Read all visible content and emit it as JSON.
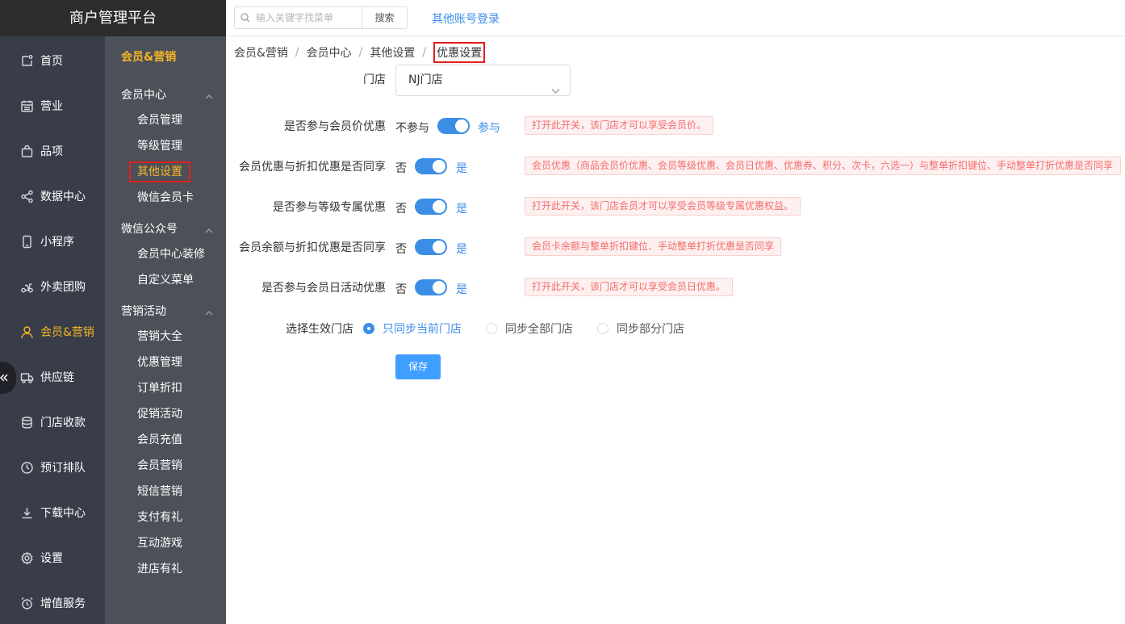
{
  "app": {
    "title": "商户管理平台"
  },
  "nav": [
    {
      "label": "首页",
      "icon": "home-icon"
    },
    {
      "label": "营业",
      "icon": "calendar-icon"
    },
    {
      "label": "品项",
      "icon": "bag-icon"
    },
    {
      "label": "数据中心",
      "icon": "share-icon"
    },
    {
      "label": "小程序",
      "icon": "phone-icon"
    },
    {
      "label": "外卖团购",
      "icon": "scooter-icon"
    },
    {
      "label": "会员&营销",
      "icon": "user-icon"
    },
    {
      "label": "供应链",
      "icon": "truck-icon"
    },
    {
      "label": "门店收款",
      "icon": "coins-icon"
    },
    {
      "label": "预订排队",
      "icon": "clock-icon"
    },
    {
      "label": "下载中心",
      "icon": "download-icon"
    },
    {
      "label": "设置",
      "icon": "gear-icon"
    },
    {
      "label": "增值服务",
      "icon": "alarm-icon"
    }
  ],
  "nav_active_index": 6,
  "sub_nav": {
    "title": "会员&营销",
    "groups": [
      {
        "title": "会员中心",
        "items": [
          "会员管理",
          "等级管理",
          "其他设置",
          "微信会员卡"
        ]
      },
      {
        "title": "微信公众号",
        "items": [
          "会员中心装修",
          "自定义菜单"
        ]
      },
      {
        "title": "营销活动",
        "items": [
          "营销大全",
          "优惠管理",
          "订单折扣",
          "促销活动",
          "会员充值",
          "会员营销",
          "短信营销",
          "支付有礼",
          "互动游戏",
          "进店有礼"
        ]
      }
    ],
    "active_item": "其他设置"
  },
  "topbar": {
    "search_placeholder": "输入关键字找菜单",
    "search_button": "搜索",
    "other_login": "其他账号登录"
  },
  "breadcrumb": [
    "会员&营销",
    "会员中心",
    "其他设置",
    "优惠设置"
  ],
  "form": {
    "store_label": "门店",
    "store_value": "NJ门店",
    "rows": [
      {
        "label": "是否参与会员价优惠",
        "off": "不参与",
        "on": "参与",
        "hint": "打开此开关，该门店才可以享受会员价。"
      },
      {
        "label": "会员优惠与折扣优惠是否同享",
        "off": "否",
        "on": "是",
        "hint": "会员优惠（商品会员价优惠、会员等级优惠、会员日优惠、优惠券、积分、次卡，六选一）与整单折扣键位、手动整单打折优惠是否同享"
      },
      {
        "label": "是否参与等级专属优惠",
        "off": "否",
        "on": "是",
        "hint": "打开此开关，该门店会员才可以享受会员等级专属优惠权益。"
      },
      {
        "label": "会员余额与折扣优惠是否同享",
        "off": "否",
        "on": "是",
        "hint": "会员卡余额与整单折扣键位、手动整单打折优惠是否同享"
      },
      {
        "label": "是否参与会员日活动优惠",
        "off": "否",
        "on": "是",
        "hint": "打开此开关，该门店才可以享受会员日优惠。"
      }
    ],
    "scope_label": "选择生效门店",
    "scope_options": [
      "只同步当前门店",
      "同步全部门店",
      "同步部分门店"
    ],
    "scope_selected": 0,
    "save_button": "保存"
  },
  "colors": {
    "accent": "#3a8ee6",
    "active_menu": "#f5b526",
    "sidebar": "#393d49",
    "hint_text": "#f56c6c"
  }
}
